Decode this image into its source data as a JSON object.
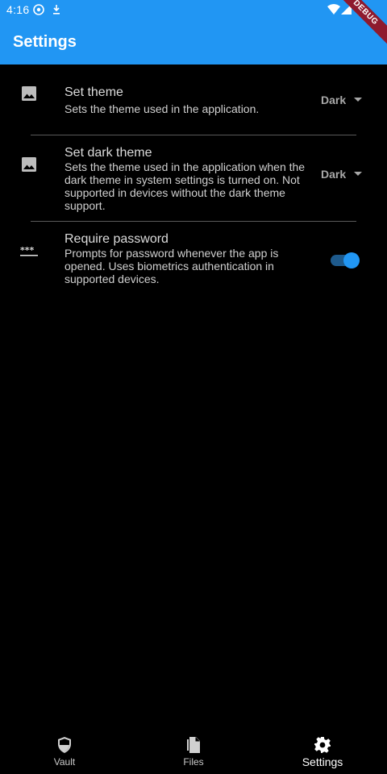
{
  "status_bar": {
    "time": "4:16"
  },
  "debug_banner": "DEBUG",
  "app_bar": {
    "title": "Settings"
  },
  "settings": [
    {
      "title": "Set theme",
      "description": "Sets the theme used in the application.",
      "value": "Dark",
      "icon": "image-icon"
    },
    {
      "title": "Set dark theme",
      "description": "Sets the theme used in the application when the dark theme in system settings is turned on. Not supported in devices without the dark theme support.",
      "value": "Dark",
      "icon": "image-icon"
    },
    {
      "title": "Require password",
      "description": "Prompts for password whenever the app is opened. Uses biometrics authentication in supported devices.",
      "enabled": true,
      "icon": "password-icon"
    }
  ],
  "bottom_nav": [
    {
      "label": "Vault",
      "icon": "shield-icon",
      "active": false
    },
    {
      "label": "Files",
      "icon": "files-icon",
      "active": false
    },
    {
      "label": "Settings",
      "icon": "gear-icon",
      "active": true
    }
  ],
  "colors": {
    "primary": "#2196f3",
    "background": "#000000",
    "toggle_track": "#1e5a8c",
    "debug_banner": "#8e1a2e"
  }
}
